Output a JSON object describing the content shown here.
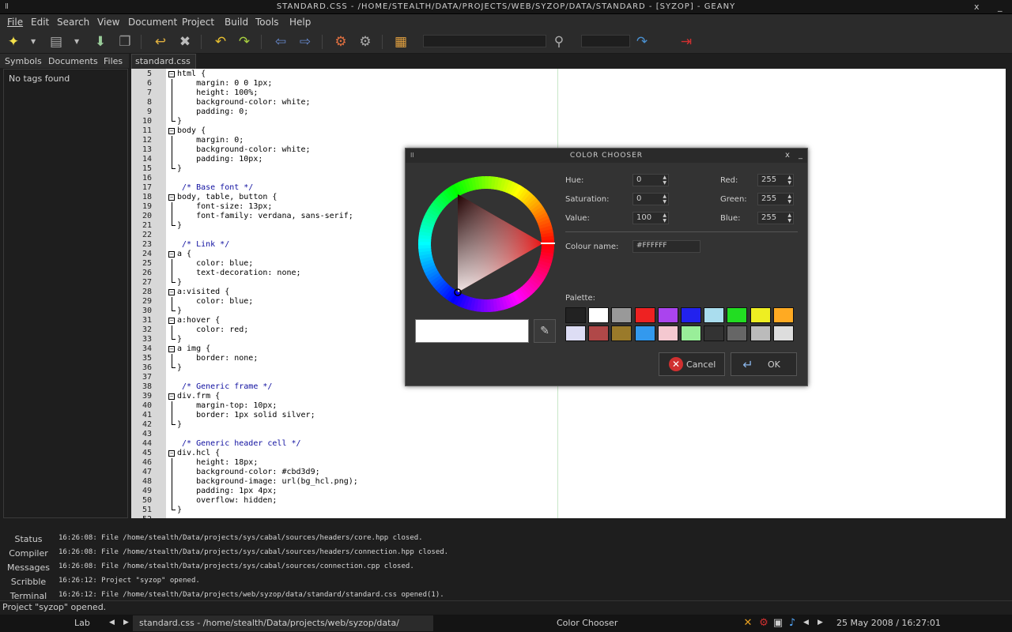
{
  "window": {
    "title": "STANDARD.CSS - /HOME/STEALTH/DATA/PROJECTS/WEB/SYZOP/DATA/STANDARD - [SYZOP] - GEANY",
    "grip": "II",
    "close": "x",
    "minimize": "_"
  },
  "menu": [
    "File",
    "Edit",
    "Search",
    "View",
    "Document",
    "Project",
    "Build",
    "Tools",
    "Help"
  ],
  "sidebar": {
    "tabs": [
      "Symbols",
      "Documents",
      "Files"
    ],
    "empty_text": "No tags found"
  },
  "document_tab": "standard.css",
  "editor": {
    "lines": [
      {
        "n": "5",
        "code": "html {",
        "fold": "open"
      },
      {
        "n": "6",
        "code": "    margin: 0 0 1px;",
        "fold": "mid"
      },
      {
        "n": "7",
        "code": "    height: 100%;",
        "fold": "mid"
      },
      {
        "n": "8",
        "code": "    background-color: white;",
        "fold": "mid"
      },
      {
        "n": "9",
        "code": "    padding: 0;",
        "fold": "mid"
      },
      {
        "n": "10",
        "code": "}",
        "fold": "end"
      },
      {
        "n": "11",
        "code": "body {",
        "fold": "open"
      },
      {
        "n": "12",
        "code": "    margin: 0;",
        "fold": "mid"
      },
      {
        "n": "13",
        "code": "    background-color: white;",
        "fold": "mid"
      },
      {
        "n": "14",
        "code": "    padding: 10px;",
        "fold": "mid"
      },
      {
        "n": "15",
        "code": "}",
        "fold": "end"
      },
      {
        "n": "16",
        "code": "",
        "fold": ""
      },
      {
        "n": "17",
        "code": " /* Base font */",
        "fold": "",
        "kind": "com"
      },
      {
        "n": "18",
        "code": "body, table, button {",
        "fold": "open"
      },
      {
        "n": "19",
        "code": "    font-size: 13px;",
        "fold": "mid"
      },
      {
        "n": "20",
        "code": "    font-family: verdana, sans-serif;",
        "fold": "mid"
      },
      {
        "n": "21",
        "code": "}",
        "fold": "end"
      },
      {
        "n": "22",
        "code": "",
        "fold": ""
      },
      {
        "n": "23",
        "code": " /* Link */",
        "fold": "",
        "kind": "com"
      },
      {
        "n": "24",
        "code": "a {",
        "fold": "open"
      },
      {
        "n": "25",
        "code": "    color: blue;",
        "fold": "mid"
      },
      {
        "n": "26",
        "code": "    text-decoration: none;",
        "fold": "mid"
      },
      {
        "n": "27",
        "code": "}",
        "fold": "end"
      },
      {
        "n": "28",
        "code": "a:visited {",
        "fold": "open"
      },
      {
        "n": "29",
        "code": "    color: blue;",
        "fold": "mid"
      },
      {
        "n": "30",
        "code": "}",
        "fold": "end"
      },
      {
        "n": "31",
        "code": "a:hover {",
        "fold": "open"
      },
      {
        "n": "32",
        "code": "    color: red;",
        "fold": "mid"
      },
      {
        "n": "33",
        "code": "}",
        "fold": "end"
      },
      {
        "n": "34",
        "code": "a img {",
        "fold": "open"
      },
      {
        "n": "35",
        "code": "    border: none;",
        "fold": "mid"
      },
      {
        "n": "36",
        "code": "}",
        "fold": "end"
      },
      {
        "n": "37",
        "code": "",
        "fold": ""
      },
      {
        "n": "38",
        "code": " /* Generic frame */",
        "fold": "",
        "kind": "com"
      },
      {
        "n": "39",
        "code": "div.frm {",
        "fold": "open"
      },
      {
        "n": "40",
        "code": "    margin-top: 10px;",
        "fold": "mid"
      },
      {
        "n": "41",
        "code": "    border: 1px solid silver;",
        "fold": "mid"
      },
      {
        "n": "42",
        "code": "}",
        "fold": "end"
      },
      {
        "n": "43",
        "code": "",
        "fold": ""
      },
      {
        "n": "44",
        "code": " /* Generic header cell */",
        "fold": "",
        "kind": "com"
      },
      {
        "n": "45",
        "code": "div.hcl {",
        "fold": "open"
      },
      {
        "n": "46",
        "code": "    height: 18px;",
        "fold": "mid"
      },
      {
        "n": "47",
        "code": "    background-color: #cbd3d9;",
        "fold": "mid"
      },
      {
        "n": "48",
        "code": "    background-image: url(bg_hcl.png);",
        "fold": "mid"
      },
      {
        "n": "49",
        "code": "    padding: 1px 4px;",
        "fold": "mid"
      },
      {
        "n": "50",
        "code": "    overflow: hidden;",
        "fold": "mid"
      },
      {
        "n": "51",
        "code": "}",
        "fold": "end"
      },
      {
        "n": "52",
        "code": "",
        "fold": ""
      }
    ]
  },
  "messages": {
    "tabs": [
      "Status",
      "Compiler",
      "Messages",
      "Scribble",
      "Terminal"
    ],
    "lines": [
      "16:26:08: File /home/stealth/Data/projects/sys/cabal/sources/headers/core.hpp closed.",
      "16:26:08: File /home/stealth/Data/projects/sys/cabal/sources/headers/connection.hpp closed.",
      "16:26:08: File /home/stealth/Data/projects/sys/cabal/sources/connection.cpp closed.",
      "16:26:12: Project \"syzop\" opened.",
      "16:26:12: File /home/stealth/Data/projects/web/syzop/data/standard/standard.css opened(1)."
    ]
  },
  "statusbar": "Project \"syzop\" opened.",
  "taskbar": {
    "workspace": "Lab",
    "prev": "◀",
    "next": "▶",
    "active_window": "standard.css - /home/stealth/Data/projects/web/syzop/data/",
    "other_window": "Color Chooser",
    "clock": "25 May 2008 / 16:27:01"
  },
  "dialog": {
    "title": "COLOR CHOOSER",
    "fields": {
      "hue_label": "Hue:",
      "hue": "0",
      "saturation_label": "Saturation:",
      "saturation": "0",
      "value_label": "Value:",
      "value": "100",
      "red_label": "Red:",
      "red": "255",
      "green_label": "Green:",
      "green": "255",
      "blue_label": "Blue:",
      "blue": "255",
      "colour_name_label": "Colour name:",
      "colour_name": "#FFFFFF"
    },
    "palette_label": "Palette:",
    "palette": [
      "#222222",
      "#ffffff",
      "#999999",
      "#ee2222",
      "#aa44ee",
      "#2222ee",
      "#aaddee",
      "#22dd22",
      "#eeee22",
      "#ffaa22",
      "#ddddf4",
      "#b04848",
      "#9a7a2a",
      "#3399ee",
      "#f4c8d0",
      "#99ee99",
      "#333333",
      "#666666",
      "#bbbbbb",
      "#dddddd"
    ],
    "cancel": "Cancel",
    "ok": "OK",
    "current_color": "#FFFFFF"
  }
}
